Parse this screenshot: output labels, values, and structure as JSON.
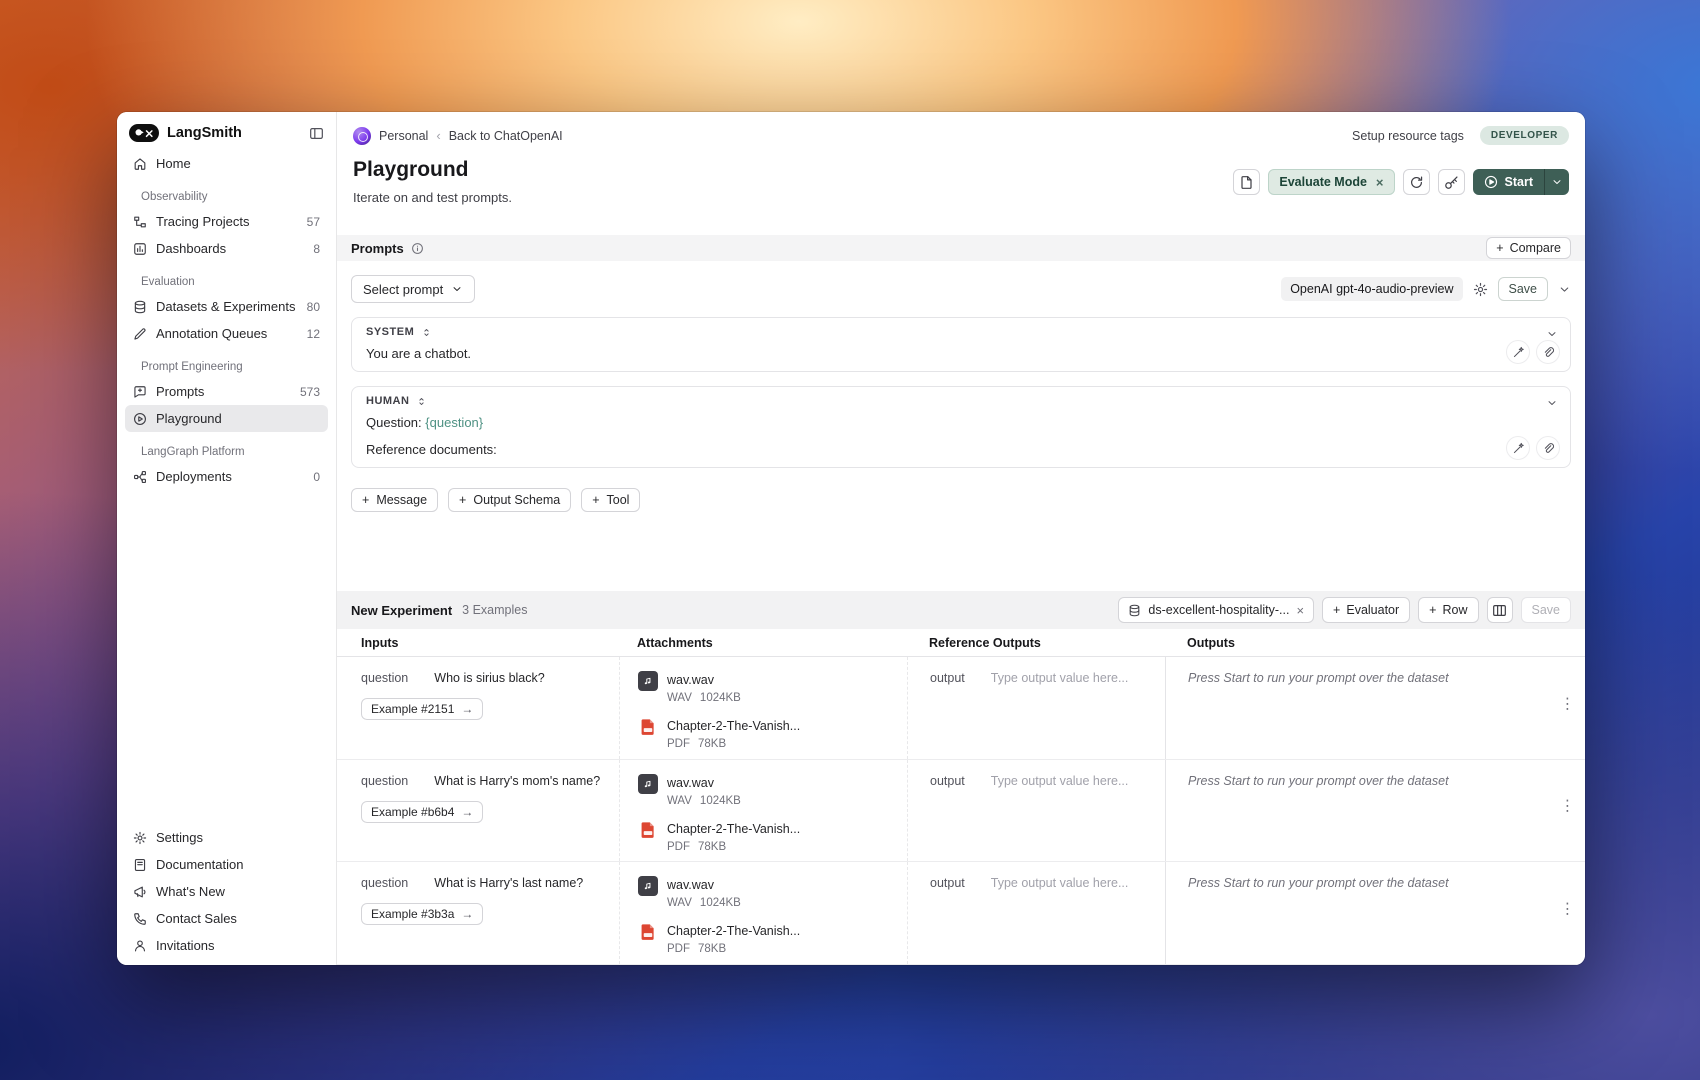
{
  "colors": {
    "accent_teal": "#3e5f56",
    "evaluate_chip_bg": "#dfeae3",
    "evaluate_chip_text": "#1c4437",
    "developer_badge_bg": "#dce8e2",
    "developer_badge_text": "#33544a",
    "variable_teal": "#4e9183",
    "pdf_red": "#dd4632",
    "audio_icon_bg": "#3f3f46"
  },
  "glyphs": {
    "plus": "+",
    "close": "×",
    "chevron_left": "‹",
    "arrow_right": "→",
    "ellipsis_v": "⋮"
  },
  "sidebar": {
    "brand": "LangSmith",
    "home": {
      "label": "Home"
    },
    "groups": [
      {
        "label": "Observability",
        "items": [
          {
            "label": "Tracing Projects",
            "count": "57"
          },
          {
            "label": "Dashboards",
            "count": "8"
          }
        ]
      },
      {
        "label": "Evaluation",
        "items": [
          {
            "label": "Datasets & Experiments",
            "count": "80"
          },
          {
            "label": "Annotation Queues",
            "count": "12"
          }
        ]
      },
      {
        "label": "Prompt Engineering",
        "items": [
          {
            "label": "Prompts",
            "count": "573"
          },
          {
            "label": "Playground",
            "count": ""
          }
        ]
      },
      {
        "label": "LangGraph Platform",
        "items": [
          {
            "label": "Deployments",
            "count": "0"
          }
        ]
      }
    ],
    "footer": [
      {
        "label": "Settings"
      },
      {
        "label": "Documentation"
      },
      {
        "label": "What's New"
      },
      {
        "label": "Contact Sales"
      },
      {
        "label": "Invitations"
      }
    ]
  },
  "titlebar": {
    "workspace": "Personal",
    "back_link": "Back to ChatOpenAI",
    "setup_resource_tags": "Setup resource tags",
    "developer_badge": "DEVELOPER"
  },
  "header": {
    "title": "Playground",
    "subtitle": "Iterate on and test prompts.",
    "evaluate_mode_label": "Evaluate Mode",
    "start_label": "Start"
  },
  "prompts": {
    "section_title": "Prompts",
    "compare_label": "Compare",
    "select_prompt_label": "Select prompt",
    "model_label": "OpenAI gpt-4o-audio-preview",
    "save_label": "Save",
    "system": {
      "role": "SYSTEM",
      "text": "You are a chatbot."
    },
    "human": {
      "role": "HUMAN",
      "question_prefix": "Question:",
      "question_variable": "{question}",
      "reference_line": "Reference documents:"
    },
    "add_message_label": "Message",
    "add_output_schema_label": "Output Schema",
    "add_tool_label": "Tool"
  },
  "experiment": {
    "title": "New Experiment",
    "examples_label": "3 Examples",
    "dataset_chip": "ds-excellent-hospitality-...",
    "evaluator_label": "Evaluator",
    "row_label": "Row",
    "save_label": "Save"
  },
  "table": {
    "headers": [
      "Inputs",
      "Attachments",
      "Reference Outputs",
      "Outputs"
    ],
    "input_key": "question",
    "output_key": "output",
    "output_placeholder": "Type output value here...",
    "outputs_empty_text": "Press Start to run your prompt over the dataset",
    "attachments": [
      {
        "name": "wav.wav",
        "type": "WAV",
        "size": "1024KB"
      },
      {
        "name": "Chapter-2-The-Vanish...",
        "type": "PDF",
        "size": "78KB"
      }
    ],
    "rows": [
      {
        "question": "Who is sirius black?",
        "example_label": "Example #2151"
      },
      {
        "question": "What is Harry's mom's name?",
        "example_label": "Example #b6b4"
      },
      {
        "question": "What is Harry's last name?",
        "example_label": "Example #3b3a"
      }
    ]
  }
}
